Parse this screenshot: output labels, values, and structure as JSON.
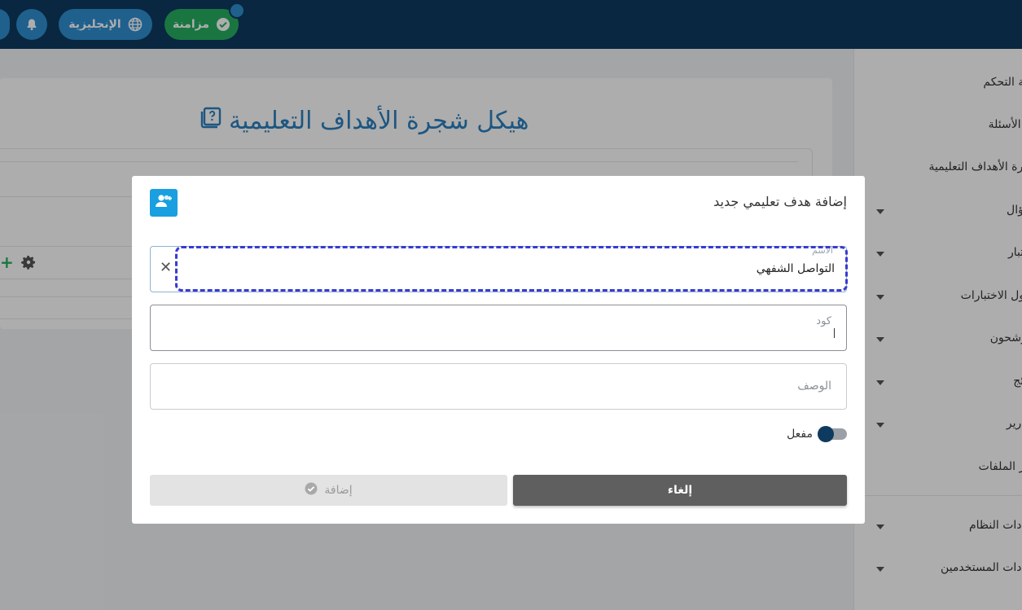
{
  "topbar": {
    "sync_label": "مزامنة",
    "language_label": "الإنجليزية",
    "icons": [
      "check-circle-icon",
      "globe-icon",
      "bell-icon"
    ]
  },
  "sidebar": {
    "items": [
      {
        "label": "لوحة التحكم",
        "has_caret": false
      },
      {
        "label": "بنك الأسئلة",
        "has_caret": false
      },
      {
        "label": "شجرة الأهداف التعليمية",
        "has_caret": false
      },
      {
        "label": "السؤال",
        "has_caret": true
      },
      {
        "label": "الاختبار",
        "has_caret": true
      },
      {
        "label": "جداول الاختبارات",
        "has_caret": true
      },
      {
        "label": "المرشحون",
        "has_caret": true
      },
      {
        "label": "النتائج",
        "has_caret": true
      },
      {
        "label": "التقارير",
        "has_caret": true
      },
      {
        "label": "مدير الملفات",
        "has_caret": false
      },
      {
        "label": "إعدادات النظام",
        "has_caret": true
      },
      {
        "label": "إعدادات المستخدمين",
        "has_caret": true
      }
    ]
  },
  "page": {
    "title": "هيكل شجرة الأهداف التعليمية"
  },
  "modal": {
    "title": "إضافة هدف تعليمي جديد",
    "name_field": {
      "label": "الاسم",
      "value": "التواصل الشفهي"
    },
    "code_field": {
      "label": "كود",
      "value": ""
    },
    "description_field": {
      "placeholder": "الوصف",
      "value": ""
    },
    "active_toggle": {
      "label": "مفعل",
      "on": true
    },
    "cancel_label": "إلغاء",
    "add_label": "إضافة"
  },
  "colors": {
    "topbar": "#0e3a5f",
    "accent": "#1a9fe0",
    "success": "#27ae60",
    "title": "#2b7fbf"
  }
}
